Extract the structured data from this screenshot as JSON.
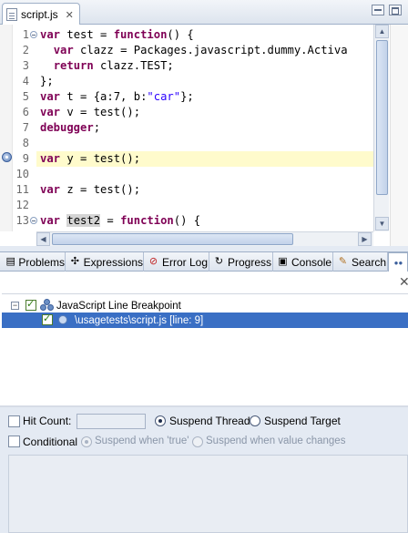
{
  "editor": {
    "tab_label": "script.js",
    "tab_close": "✕",
    "lines": [
      {
        "n": "1",
        "html": "<span class=\"kw\">var</span> test = <span class=\"kw\">function</span>() {"
      },
      {
        "n": "2",
        "html": "  <span class=\"kw\">var</span> clazz = Packages.javascript.dummy.Activa"
      },
      {
        "n": "3",
        "html": "  <span class=\"kw\">return</span> clazz.TEST;"
      },
      {
        "n": "4",
        "html": "};"
      },
      {
        "n": "5",
        "html": "<span class=\"kw\">var</span> t = {a:7, b:<span class=\"str\">\"car\"</span>};"
      },
      {
        "n": "6",
        "html": "<span class=\"kw\">var</span> v = test();"
      },
      {
        "n": "7",
        "html": "<span class=\"kw\">debugger</span>;"
      },
      {
        "n": "8",
        "html": ""
      },
      {
        "n": "9",
        "html": "<span class=\"kw\">var</span> y = test();"
      },
      {
        "n": "10",
        "html": ""
      },
      {
        "n": "11",
        "html": "<span class=\"kw\">var</span> z = test();"
      },
      {
        "n": "12",
        "html": ""
      },
      {
        "n": "13",
        "html": "<span class=\"kw\">var</span> <span class=\"var-sel\">test2</span> = <span class=\"kw\">function</span>() {"
      }
    ],
    "highlighted_line": "9"
  },
  "views": {
    "tabs": [
      {
        "label": "Problems",
        "icon": "problems-icon",
        "glyph": "▤"
      },
      {
        "label": "Expressions",
        "icon": "expressions-icon",
        "glyph": "✣"
      },
      {
        "label": "Error Log",
        "icon": "error-log-icon",
        "glyph": "⊘"
      },
      {
        "label": "Progress",
        "icon": "progress-icon",
        "glyph": "↻"
      },
      {
        "label": "Console",
        "icon": "console-icon",
        "glyph": "▣"
      },
      {
        "label": "Search",
        "icon": "search-icon",
        "glyph": "✎"
      },
      {
        "label": "",
        "icon": "breakpoints-icon",
        "glyph": "●●"
      }
    ],
    "toolbar_remove": "✕"
  },
  "breakpoints": {
    "group_label": "JavaScript Line Breakpoint",
    "group_toggle": "−",
    "item_label": "\\usagetests\\script.js [line: 9]"
  },
  "properties": {
    "hit_count_label": "Hit Count:",
    "hit_count_value": "",
    "suspend_thread_label": "Suspend Thread",
    "suspend_target_label": "Suspend Target",
    "conditional_label": "Conditional",
    "suspend_true_label": "Suspend when 'true'",
    "suspend_changes_label": "Suspend when value changes"
  }
}
